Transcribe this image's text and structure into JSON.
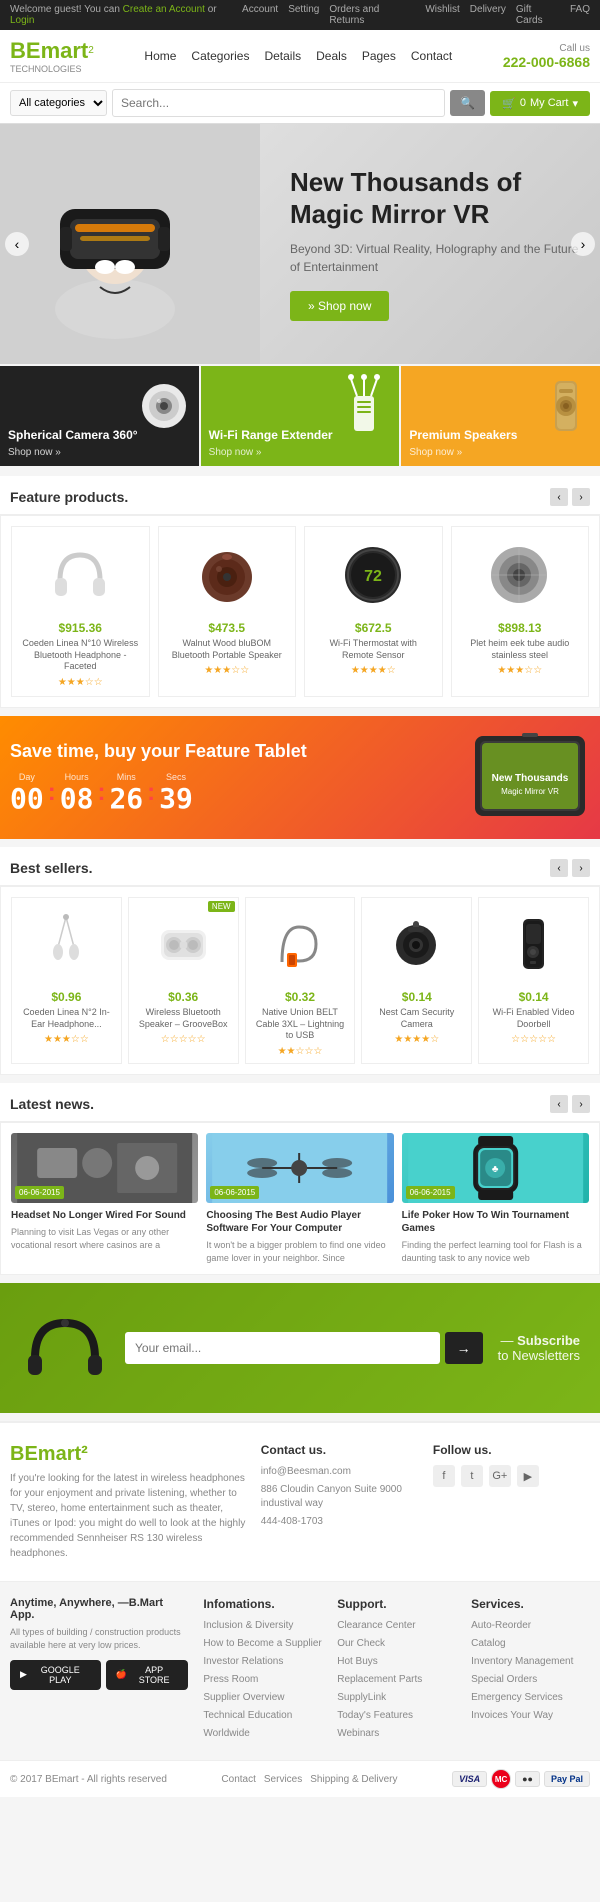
{
  "topbar": {
    "welcome": "Welcome guest! You can",
    "create": "Create an Account",
    "or": "or",
    "login": "Login",
    "account": "Account",
    "setting": "Setting",
    "orders": "Orders and Returns",
    "wishlist": "Wishlist",
    "delivery": "Delivery",
    "gift_cards": "Gift Cards",
    "faq": "FAQ"
  },
  "header": {
    "logo_be": "BE",
    "logo_mart": "mart",
    "logo_sup": "2",
    "logo_sub": "TECHNOLOGIES",
    "call_label": "Call us",
    "phone": "222-000-6868",
    "nav": {
      "home": "Home",
      "categories": "Categories",
      "details": "Details",
      "deals": "Deals",
      "pages": "Pages",
      "contact": "Contact"
    }
  },
  "search": {
    "category_placeholder": "All categories",
    "input_placeholder": "Search...",
    "cart_label": "My Cart",
    "cart_count": "0"
  },
  "hero": {
    "title": "New Thousands of Magic Mirror VR",
    "subtitle": "Beyond 3D: Virtual Reality, Holography and the Future of Entertainment",
    "button": "» Shop now"
  },
  "banners": [
    {
      "title": "Spherical Camera 360°",
      "link": "Shop now »",
      "color": "dark"
    },
    {
      "title": "Wi-Fi Range Extender",
      "link": "Shop now »",
      "color": "green"
    },
    {
      "title": "Premium Speakers",
      "link": "Shop now »",
      "color": "yellow"
    }
  ],
  "featured": {
    "section_title": "Feature products.",
    "products": [
      {
        "price": "$915.36",
        "name": "Coeden Linea N°10 Wireless Bluetooth Headphone - Faceted",
        "stars": 3
      },
      {
        "price": "$473.5",
        "name": "Walnut Wood bluBOM Bluetooth Portable Speaker",
        "stars": 3
      },
      {
        "price": "$672.5",
        "name": "Wi-Fi Thermostat with Remote Sensor",
        "stars": 4
      },
      {
        "price": "$898.13",
        "name": "Plet heim eek tube audio stainless steel",
        "stars": 3
      }
    ]
  },
  "countdown": {
    "title": "Save time, buy your Feature Tablet",
    "time": {
      "day": "00",
      "hours": "08",
      "mins": "26",
      "secs": "39",
      "day_label": "Day",
      "hours_label": "Hours",
      "mins_label": "Mins",
      "secs_label": "Secs"
    }
  },
  "bestsellers": {
    "section_title": "Best sellers.",
    "products": [
      {
        "price": "$0.96",
        "name": "Coeden Linea N°2 In-Ear Headphone...",
        "stars": 3,
        "new": false
      },
      {
        "price": "$0.36",
        "name": "Wireless Bluetooth Speaker – GrooveBox",
        "stars": 0,
        "new": true
      },
      {
        "price": "$0.32",
        "name": "Native Union BELT Cable 3XL – Lightning to USB",
        "stars": 2,
        "new": false
      },
      {
        "price": "$0.14",
        "name": "Nest Cam Security Camera",
        "stars": 4,
        "new": false
      },
      {
        "price": "$0.14",
        "name": "Wi-Fi Enabled Video Doorbell",
        "stars": 0,
        "new": false
      }
    ]
  },
  "news": {
    "section_title": "Latest news.",
    "articles": [
      {
        "date": "06-06-2015",
        "title": "Headset No Longer Wired For Sound",
        "excerpt": "Planning to visit Las Vegas or any other vocational resort where casinos are a"
      },
      {
        "date": "06-06-2015",
        "title": "Choosing The Best Audio Player Software For Your Computer",
        "excerpt": "It won't be a bigger problem to find one video game lover in your neighbor. Since"
      },
      {
        "date": "06-06-2015",
        "title": "Life Poker How To Win Tournament Games",
        "excerpt": "Finding the perfect learning tool for Flash is a daunting task to any novice web"
      }
    ]
  },
  "newsletter": {
    "email_placeholder": "Your email...",
    "dash": "—",
    "subscribe": "Subscribe",
    "to_newsletters": "to Newsletters"
  },
  "footer": {
    "logo": "BEmart²",
    "description": "If you're looking for the latest in wireless headphones for your enjoyment and private listening, whether to TV, stereo, home entertainment such as theater, iTunes or Ipod: you might do well to look at the highly recommended Sennheiser RS 130 wireless headphones.",
    "contact_title": "Contact us.",
    "contact_email": "info@Beesman.com",
    "contact_address": "886 Cloudin Canyon Suite 9000 industival way",
    "contact_phone": "444-408-1703",
    "follow_title": "Follow us.",
    "follow_icons": [
      "f",
      "t",
      "G+",
      "▶"
    ],
    "app_title": "Anytime, Anywhere, —B.Mart App.",
    "app_desc": "All types of building / construction products available here at very low prices.",
    "google_play": "GOOGLE PLAY",
    "app_store": "APP STORE",
    "infomations_title": "Infomations.",
    "infomations_links": [
      "Inclusion & Diversity",
      "How to Become a Supplier",
      "Investor Relations",
      "Press Room",
      "Supplier Overview",
      "Technical Education",
      "Worldwide"
    ],
    "support_title": "Support.",
    "support_links": [
      "Clearance Center",
      "Our Check",
      "Hot Buys",
      "Replacement Parts",
      "SupplyLink",
      "Today's Features",
      "Webinars"
    ],
    "services_title": "Services.",
    "services_links": [
      "Auto-Reorder",
      "Catalog",
      "Inventory Management",
      "Special Orders",
      "Emergency Services",
      "Invoices Your Way"
    ],
    "copyright": "© 2017 BEmart - All rights reserved",
    "bottom_links": [
      "Contact",
      "Services",
      "Shipping & Delivery"
    ],
    "payment_icons": [
      "VISA",
      "MC",
      "●●",
      "Pay Pal"
    ]
  }
}
